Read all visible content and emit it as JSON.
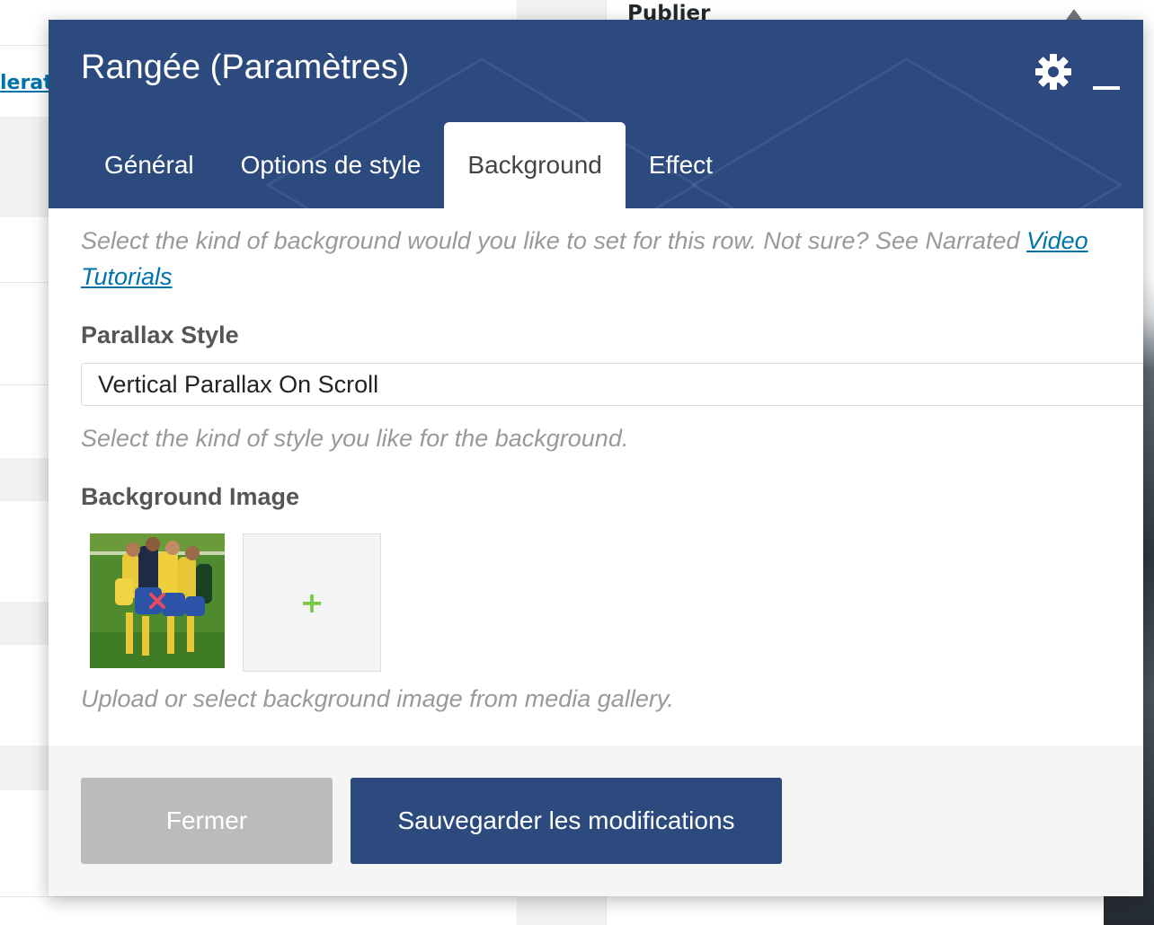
{
  "background_page": {
    "link_fragment": "lerat",
    "sidebar_box_title": "Publier"
  },
  "modal": {
    "title": "Rangée (Paramètres)",
    "header_icons": [
      "gear-icon",
      "minimize-icon"
    ],
    "tabs": [
      {
        "label": "Général",
        "active": false
      },
      {
        "label": "Options de style",
        "active": false
      },
      {
        "label": "Background",
        "active": true
      },
      {
        "label": "Effect",
        "active": false
      }
    ],
    "intro": {
      "text": "Select the kind of background would you like to set for this row. Not sure? See Narrated ",
      "link_text": "Video Tutorials"
    },
    "parallax": {
      "label": "Parallax Style",
      "value": "Vertical Parallax On Scroll",
      "help": "Select the kind of style you like for the background."
    },
    "background_image": {
      "label": "Background Image",
      "add_symbol": "+",
      "help": "Upload or select background image from media gallery."
    },
    "footer": {
      "close_label": "Fermer",
      "save_label": "Sauvegarder les modifications"
    }
  },
  "colors": {
    "header_bg": "#2d4a7f",
    "close_button_bg": "#bbbbbb",
    "link": "#0073aa",
    "add_plus": "#7ac943"
  }
}
